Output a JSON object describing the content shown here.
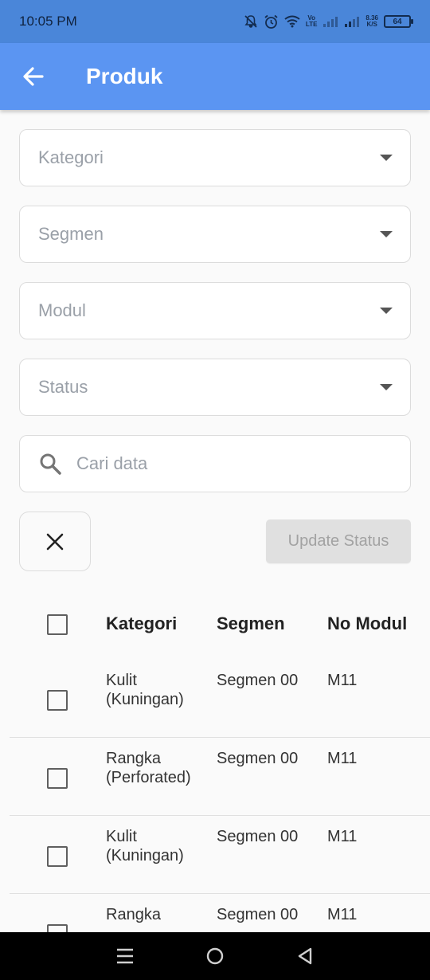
{
  "status_bar": {
    "time": "10:05 PM",
    "network_top": "Vo",
    "network_bottom": "LTE",
    "speed_value": "8.36",
    "speed_unit": "K/S",
    "battery": "64",
    "icons": [
      "mute-bell-icon",
      "alarm-icon",
      "wifi-icon",
      "signal-icon",
      "signal-icon",
      "battery-icon"
    ]
  },
  "app_bar": {
    "title": "Produk",
    "back_icon": "arrow-left-icon",
    "background": "#5b95f2"
  },
  "filters": {
    "kategori": {
      "placeholder": "Kategori"
    },
    "segmen": {
      "placeholder": "Segmen"
    },
    "modul": {
      "placeholder": "Modul"
    },
    "status": {
      "placeholder": "Status"
    }
  },
  "search": {
    "placeholder": "Cari data",
    "value": ""
  },
  "actions": {
    "clear_icon": "close-icon",
    "update_label": "Update Status"
  },
  "table": {
    "headers": [
      "Kategori",
      "Segmen",
      "No Modul"
    ],
    "rows": [
      {
        "kategori": "Kulit (Kuningan)",
        "segmen": "Segmen 00",
        "modul": "M11",
        "checked": false
      },
      {
        "kategori": "Rangka (Perforated)",
        "segmen": "Segmen 00",
        "modul": "M11",
        "checked": false
      },
      {
        "kategori": "Kulit (Kuningan)",
        "segmen": "Segmen 00",
        "modul": "M11",
        "checked": false
      },
      {
        "kategori": "Rangka",
        "segmen": "Segmen 00",
        "modul": "M11",
        "checked": false
      }
    ]
  },
  "nav_bar": {
    "icons": [
      "menu-icon",
      "home-circle-icon",
      "back-triangle-icon"
    ]
  }
}
